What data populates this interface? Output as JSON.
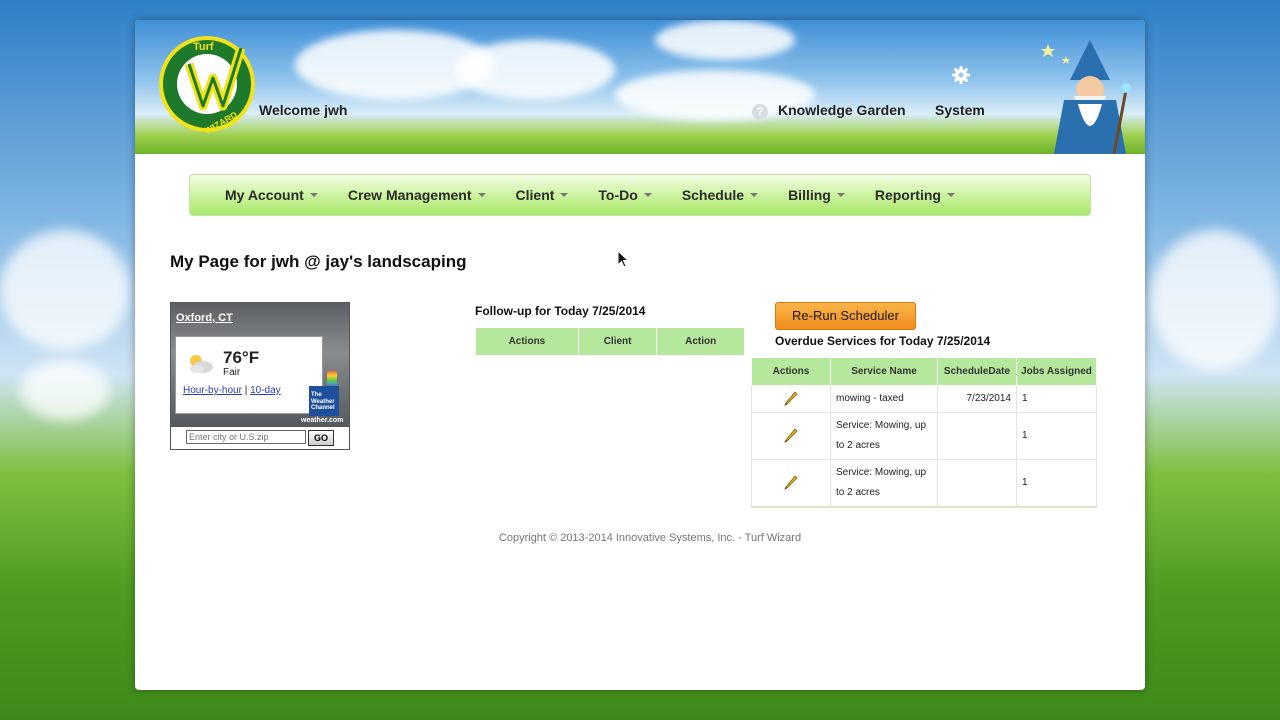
{
  "header": {
    "logo_text_top": "Turf",
    "logo_text_bottom": "WIZARD",
    "welcome": "Welcome jwh",
    "knowledge_garden": "Knowledge Garden",
    "system": "System",
    "help_glyph": "?"
  },
  "nav": {
    "items": [
      {
        "label": "My Account"
      },
      {
        "label": "Crew Management"
      },
      {
        "label": "Client"
      },
      {
        "label": "To-Do"
      },
      {
        "label": "Schedule"
      },
      {
        "label": "Billing"
      },
      {
        "label": "Reporting"
      }
    ]
  },
  "main": {
    "page_title": "My Page for jwh @ jay's landscaping"
  },
  "weather": {
    "city": "Oxford, CT",
    "temperature": "76°F",
    "condition": "Fair",
    "link_hourly": "Hour-by-hour",
    "separator": "|",
    "link_10day": "10-day",
    "brand_logo": "The Weather Channel",
    "brand_url": "weather.com",
    "input_placeholder": "Enter city or U.S.zip",
    "go_label": "GO"
  },
  "followup": {
    "title": "Follow-up for Today 7/25/2014",
    "columns": [
      "Actions",
      "Client",
      "Action"
    ]
  },
  "overdue": {
    "rerun_label": "Re-Run Scheduler",
    "title": "Overdue Services for Today 7/25/2014",
    "columns": [
      "Actions",
      "Service Name",
      "ScheduleDate",
      "Jobs Assigned"
    ],
    "rows": [
      {
        "service": "mowing - taxed",
        "date": "7/23/2014",
        "jobs": "1"
      },
      {
        "service": "Service: Mowing, up to 2 acres",
        "date": "",
        "jobs": "1"
      },
      {
        "service": "Service: Mowing, up to 2 acres",
        "date": "",
        "jobs": "1"
      }
    ]
  },
  "footer": {
    "copyright": "Copyright © 2013-2014 Innovative Systems, Inc. - Turf Wizard"
  },
  "colors": {
    "nav_gradient_top": "#f2fde4",
    "nav_gradient_bottom": "#a8e86c",
    "table_header": "#b5e89c",
    "button_orange": "#f18d1a",
    "link_blue": "#2a3fb0"
  }
}
